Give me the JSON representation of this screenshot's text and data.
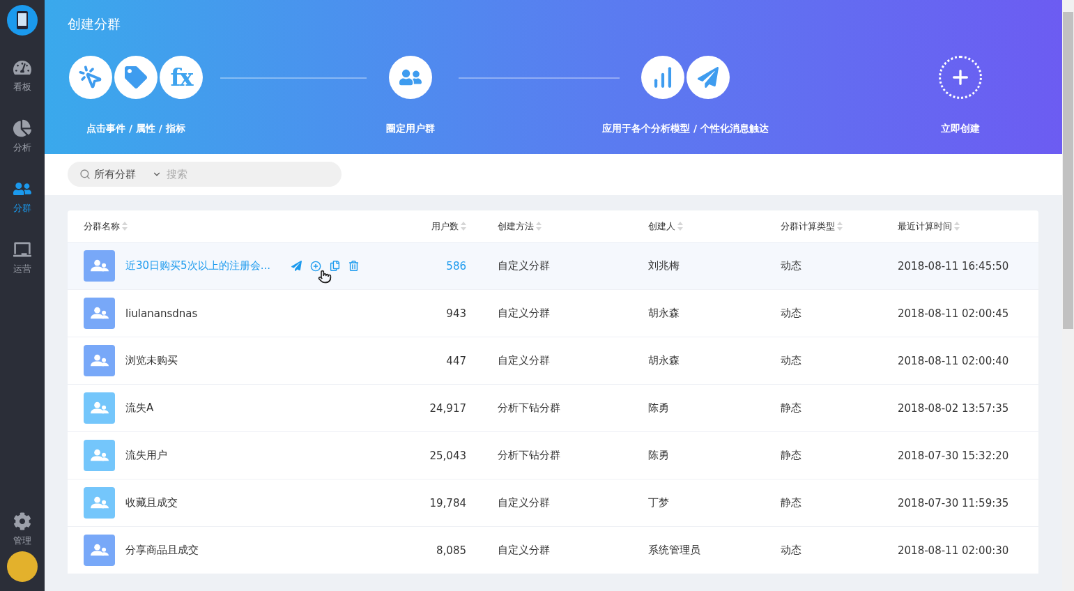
{
  "sidebar": {
    "items": [
      {
        "label": "看板",
        "kind": "gauge",
        "selected": false
      },
      {
        "label": "分析",
        "kind": "pie",
        "selected": false
      },
      {
        "label": "分群",
        "kind": "users",
        "selected": true
      },
      {
        "label": "运营",
        "kind": "board",
        "selected": false
      }
    ],
    "bottom_items": [
      {
        "label": "管理",
        "kind": "gear",
        "selected": false
      }
    ]
  },
  "header": {
    "title": "创建分群",
    "steps": [
      {
        "icons": [
          {
            "kind": "click"
          },
          {
            "kind": "tag"
          },
          {
            "kind": "text",
            "text": "fx"
          }
        ],
        "label": "点击事件 / 属性 / 指标"
      },
      {
        "icons": [
          {
            "kind": "users"
          }
        ],
        "label": "圈定用户群"
      },
      {
        "icons": [
          {
            "kind": "chart"
          },
          {
            "kind": "plane"
          }
        ],
        "label": "应用于各个分析模型 / 个性化消息触达"
      }
    ],
    "create": {
      "label": "立即创建"
    }
  },
  "search": {
    "scope": "所有分群",
    "placeholder": "搜索"
  },
  "table": {
    "columns": [
      "分群名称",
      "用户数",
      "创建方法",
      "创建人",
      "分群计算类型",
      "最近计算时间"
    ],
    "rows": [
      {
        "name": "近30日购买5次以上的注册会...",
        "users": "586",
        "method": "自定义分群",
        "creator": "刘兆梅",
        "type": "动态",
        "time": "2018-08-11 16:45:50",
        "color": "#78a8f8",
        "selected": true
      },
      {
        "name": "liulanansdnas",
        "users": "943",
        "method": "自定义分群",
        "creator": "胡永森",
        "type": "动态",
        "time": "2018-08-11 02:00:45",
        "color": "#78a8f8",
        "selected": false
      },
      {
        "name": "浏览未购买",
        "users": "447",
        "method": "自定义分群",
        "creator": "胡永森",
        "type": "动态",
        "time": "2018-08-11 02:00:40",
        "color": "#78a8f8",
        "selected": false
      },
      {
        "name": "流失A",
        "users": "24,917",
        "method": "分析下钻分群",
        "creator": "陈勇",
        "type": "静态",
        "time": "2018-08-02 13:57:35",
        "color": "#74c6fb",
        "selected": false
      },
      {
        "name": "流失用户",
        "users": "25,043",
        "method": "分析下钻分群",
        "creator": "陈勇",
        "type": "静态",
        "time": "2018-07-30 15:32:20",
        "color": "#74c6fb",
        "selected": false
      },
      {
        "name": "收藏且成交",
        "users": "19,784",
        "method": "自定义分群",
        "creator": "丁梦",
        "type": "静态",
        "time": "2018-07-30 11:59:35",
        "color": "#74c6fb",
        "selected": false
      },
      {
        "name": "分享商品且成交",
        "users": "8,085",
        "method": "自定义分群",
        "creator": "系统管理员",
        "type": "动态",
        "time": "2018-08-11 02:00:30",
        "color": "#78a8f8",
        "selected": false
      }
    ]
  }
}
